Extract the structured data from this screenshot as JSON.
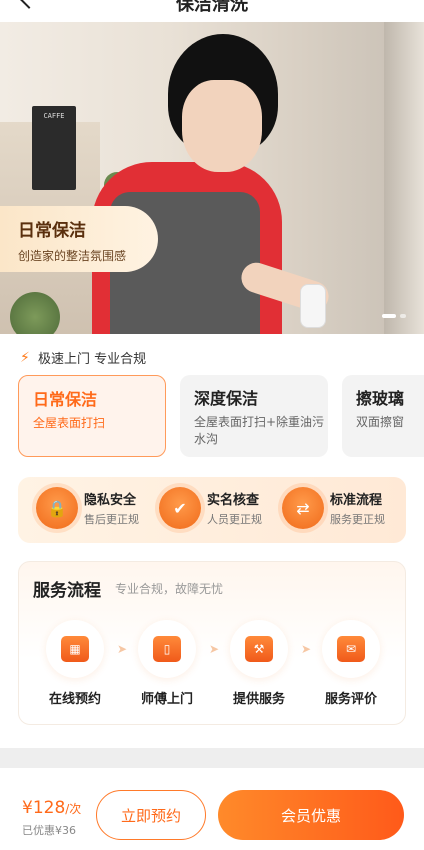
{
  "header": {
    "title": "保洁清洗"
  },
  "banner": {
    "tag_title": "日常保洁",
    "tag_sub": "创造家的整洁氛围感",
    "board_text": "CAFFE",
    "slides": 2
  },
  "promise": {
    "text": "极速上门 专业合规",
    "icon": "bolt-icon"
  },
  "tabs": [
    {
      "name": "日常保洁",
      "desc": "全屋表面打扫",
      "active": true
    },
    {
      "name": "深度保洁",
      "desc": "全屋表面打扫+除重油污水沟",
      "active": false
    },
    {
      "name": "擦玻璃",
      "desc": "双面擦窗",
      "active": false
    }
  ],
  "guarantees": [
    {
      "title": "隐私安全",
      "sub": "售后更正规",
      "icon": "shield-lock-icon"
    },
    {
      "title": "实名核查",
      "sub": "人员更正规",
      "icon": "user-check-icon"
    },
    {
      "title": "标准流程",
      "sub": "服务更正规",
      "icon": "flow-icon"
    }
  ],
  "process": {
    "title": "服务流程",
    "sub": "专业合规，故障无忧",
    "steps": [
      {
        "label": "在线预约",
        "icon": "calendar-icon"
      },
      {
        "label": "师傅上门",
        "icon": "door-icon"
      },
      {
        "label": "提供服务",
        "icon": "worker-icon"
      },
      {
        "label": "服务评价",
        "icon": "rating-mail-icon"
      }
    ]
  },
  "footer": {
    "price": "¥128",
    "price_unit": "/次",
    "discount": "已优惠¥36",
    "book_label": "立即预约",
    "vip_label": "会员优惠"
  },
  "colors": {
    "accent": "#ff6a1a",
    "accent_light": "#fff3ec"
  }
}
